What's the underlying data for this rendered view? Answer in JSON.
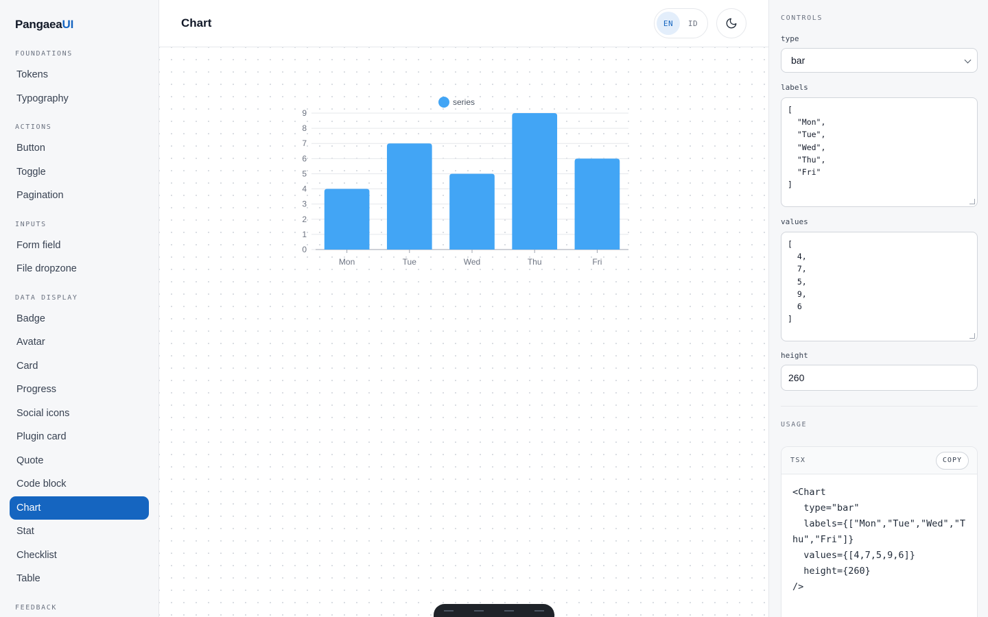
{
  "brand": {
    "name": "Pangaea",
    "accent": "UI"
  },
  "sidebar": {
    "sections": [
      {
        "title": "FOUNDATIONS",
        "items": [
          "Tokens",
          "Typography"
        ]
      },
      {
        "title": "ACTIONS",
        "items": [
          "Button",
          "Toggle",
          "Pagination"
        ]
      },
      {
        "title": "INPUTS",
        "items": [
          "Form field",
          "File dropzone"
        ]
      },
      {
        "title": "DATA DISPLAY",
        "items": [
          "Badge",
          "Avatar",
          "Card",
          "Progress",
          "Social icons",
          "Plugin card",
          "Quote",
          "Code block",
          "Chart",
          "Stat",
          "Checklist",
          "Table"
        ]
      },
      {
        "title": "FEEDBACK",
        "items": []
      }
    ],
    "active_item": "Chart"
  },
  "header": {
    "title": "Chart",
    "lang_options": [
      "EN",
      "ID"
    ],
    "active_lang": "EN",
    "theme_icon": "moon-icon"
  },
  "chart_data": {
    "type": "bar",
    "categories": [
      "Mon",
      "Tue",
      "Wed",
      "Thu",
      "Fri"
    ],
    "series": [
      {
        "name": "series",
        "values": [
          4,
          7,
          5,
          9,
          6
        ]
      }
    ],
    "ylim": [
      0,
      9
    ],
    "yticks": [
      0,
      1,
      2,
      3,
      4,
      5,
      6,
      7,
      8,
      9
    ],
    "grid": true,
    "legend": "top-center",
    "color": "#42a5f5"
  },
  "controls": {
    "heading": "CONTROLS",
    "type_label": "type",
    "type_value": "bar",
    "labels_label": "labels",
    "labels_value": "[\n  \"Mon\",\n  \"Tue\",\n  \"Wed\",\n  \"Thu\",\n  \"Fri\"\n]",
    "values_label": "values",
    "values_value": "[\n  4,\n  7,\n  5,\n  9,\n  6\n]",
    "height_label": "height",
    "height_value": "260"
  },
  "usage": {
    "heading": "USAGE",
    "lang": "TSX",
    "copy_label": "COPY",
    "code": "<Chart\n  type=\"bar\"\n  labels={[\"Mon\",\"Tue\",\"Wed\",\"Thu\",\"Fri\"]}\n  values={[4,7,5,9,6]}\n  height={260}\n/>"
  },
  "colors": {
    "accent": "#1565c0",
    "bar": "#42a5f5"
  }
}
